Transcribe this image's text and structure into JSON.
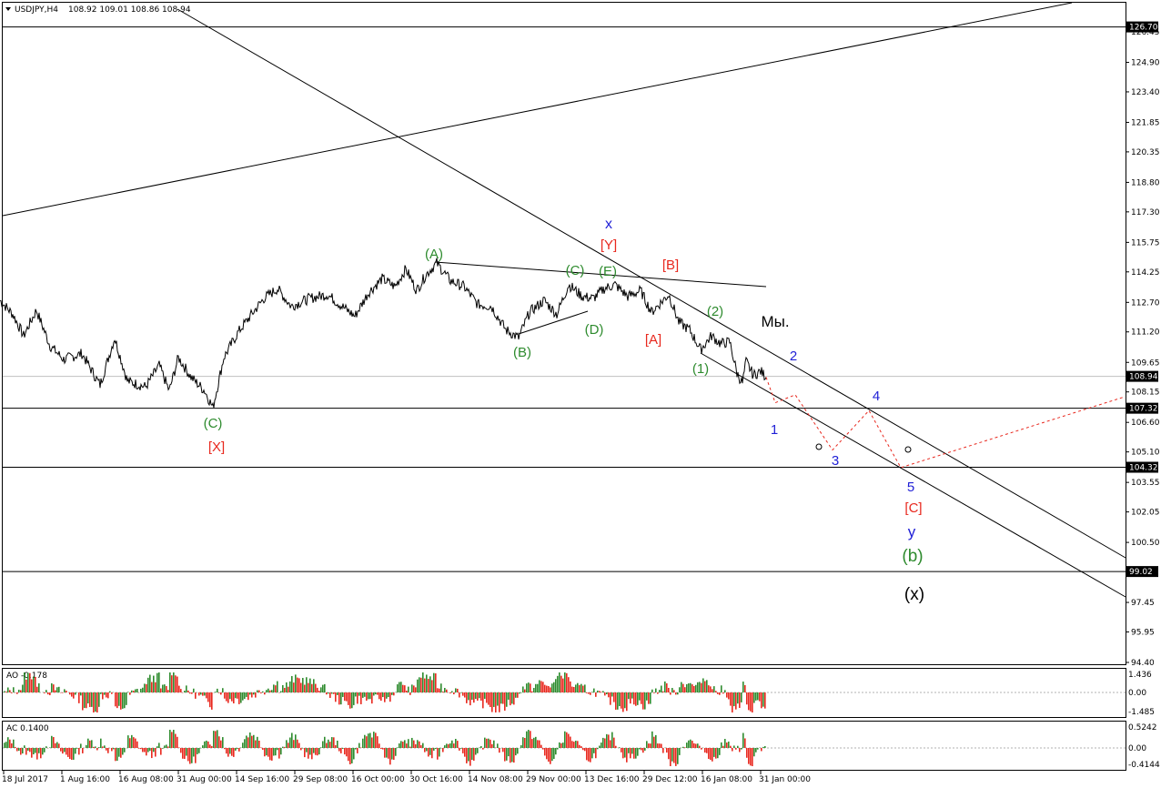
{
  "header": {
    "symbol": "USDJPY,H4",
    "ohlc": "108.92 109.01 108.86 108.94"
  },
  "indicators": {
    "ao_label": "AO -0.178",
    "ac_label": "AC 0.1400",
    "ao_ticks": [
      "1.436",
      "0.00",
      "-1.485"
    ],
    "ac_ticks": [
      "0.5242",
      "0.00",
      "-0.4144"
    ]
  },
  "colors": {
    "price_line": "#000000",
    "up_bar": "#2e8b2e",
    "down_bar": "#e8281e",
    "projection": "#e8281e",
    "label_green": "#2e8b2e",
    "label_red": "#e8281e",
    "label_blue": "#1f1fd6"
  },
  "chart_data": {
    "type": "line",
    "title": "USDJPY,H4",
    "ylim": [
      93.5,
      127.9
    ],
    "y_ticks": [
      "126.45",
      "124.90",
      "123.40",
      "121.85",
      "120.35",
      "118.80",
      "117.30",
      "115.75",
      "114.25",
      "112.70",
      "111.20",
      "109.65",
      "108.15",
      "106.60",
      "105.10",
      "103.55",
      "102.05",
      "100.50",
      "99.00",
      "97.45",
      "95.95",
      "94.40"
    ],
    "x_tick_labels": [
      "18 Jul 2017",
      "1 Aug 16:00",
      "16 Aug 08:00",
      "31 Aug 00:00",
      "14 Sep 16:00",
      "29 Sep 08:00",
      "16 Oct 00:00",
      "30 Oct 16:00",
      "14 Nov 08:00",
      "29 Nov 00:00",
      "13 Dec 16:00",
      "29 Dec 12:00",
      "16 Jan 08:00",
      "31 Jan 00:00"
    ],
    "current_price": "108.94",
    "horizontal_levels": [
      "126.70",
      "107.32",
      "104.32",
      "99.02"
    ],
    "price_path": [
      [
        0,
        112.8
      ],
      [
        14,
        112.1
      ],
      [
        26,
        111.0
      ],
      [
        40,
        112.3
      ],
      [
        55,
        110.5
      ],
      [
        70,
        109.8
      ],
      [
        90,
        110.1
      ],
      [
        110,
        108.5
      ],
      [
        126,
        110.9
      ],
      [
        140,
        108.7
      ],
      [
        160,
        108.4
      ],
      [
        175,
        109.5
      ],
      [
        186,
        108.2
      ],
      [
        196,
        109.9
      ],
      [
        210,
        108.9
      ],
      [
        225,
        108.2
      ],
      [
        234,
        107.35
      ],
      [
        246,
        109.9
      ],
      [
        262,
        111.2
      ],
      [
        275,
        112.0
      ],
      [
        290,
        112.9
      ],
      [
        305,
        113.4
      ],
      [
        320,
        112.5
      ],
      [
        340,
        112.9
      ],
      [
        360,
        113.1
      ],
      [
        376,
        112.5
      ],
      [
        390,
        112.0
      ],
      [
        405,
        113.2
      ],
      [
        420,
        113.9
      ],
      [
        434,
        113.5
      ],
      [
        446,
        114.4
      ],
      [
        458,
        113.3
      ],
      [
        468,
        114.1
      ],
      [
        480,
        114.7
      ],
      [
        495,
        113.8
      ],
      [
        510,
        113.5
      ],
      [
        525,
        112.6
      ],
      [
        540,
        112.5
      ],
      [
        556,
        111.3
      ],
      [
        570,
        110.9
      ],
      [
        582,
        112.2
      ],
      [
        598,
        112.8
      ],
      [
        612,
        112.1
      ],
      [
        625,
        113.6
      ],
      [
        640,
        113.0
      ],
      [
        652,
        112.9
      ],
      [
        664,
        113.4
      ],
      [
        676,
        113.6
      ],
      [
        690,
        113.0
      ],
      [
        704,
        113.3
      ],
      [
        716,
        112.2
      ],
      [
        735,
        113.1
      ],
      [
        746,
        111.7
      ],
      [
        758,
        111.3
      ],
      [
        770,
        110.3
      ],
      [
        782,
        111.0
      ],
      [
        792,
        110.6
      ],
      [
        802,
        110.7
      ],
      [
        810,
        109.1
      ],
      [
        816,
        108.6
      ],
      [
        820,
        109.7
      ],
      [
        828,
        109.0
      ],
      [
        836,
        109.2
      ],
      [
        842,
        108.9
      ]
    ],
    "projection_path": [
      [
        842,
        108.9
      ],
      [
        852,
        107.6
      ],
      [
        874,
        108.0
      ],
      [
        915,
        105.2
      ],
      [
        955,
        107.2
      ],
      [
        990,
        104.3
      ],
      [
        1236,
        107.9
      ]
    ],
    "wave_labels": [
      {
        "text": "x",
        "color": "blue"
      },
      {
        "text": "[Y]",
        "color": "red"
      },
      {
        "text": "[B]",
        "color": "red"
      },
      {
        "text": "(A)",
        "color": "green"
      },
      {
        "text": "(C)",
        "color": "green"
      },
      {
        "text": "(E)",
        "color": "green"
      },
      {
        "text": "(2)",
        "color": "green"
      },
      {
        "text": "Мы.",
        "color": "black"
      },
      {
        "text": "(D)",
        "color": "green"
      },
      {
        "text": "(B)",
        "color": "green"
      },
      {
        "text": "[A]",
        "color": "red"
      },
      {
        "text": "(1)",
        "color": "green"
      },
      {
        "text": "2",
        "color": "blue"
      },
      {
        "text": "4",
        "color": "blue"
      },
      {
        "text": "1",
        "color": "blue"
      },
      {
        "text": "3",
        "color": "blue"
      },
      {
        "text": "5",
        "color": "blue"
      },
      {
        "text": "[C]",
        "color": "red"
      },
      {
        "text": "y",
        "color": "blue"
      },
      {
        "text": "(b)",
        "color": "green"
      },
      {
        "text": "(x)",
        "color": "black"
      },
      {
        "text": "(C)",
        "color": "green"
      },
      {
        "text": "[X]",
        "color": "red"
      }
    ]
  }
}
